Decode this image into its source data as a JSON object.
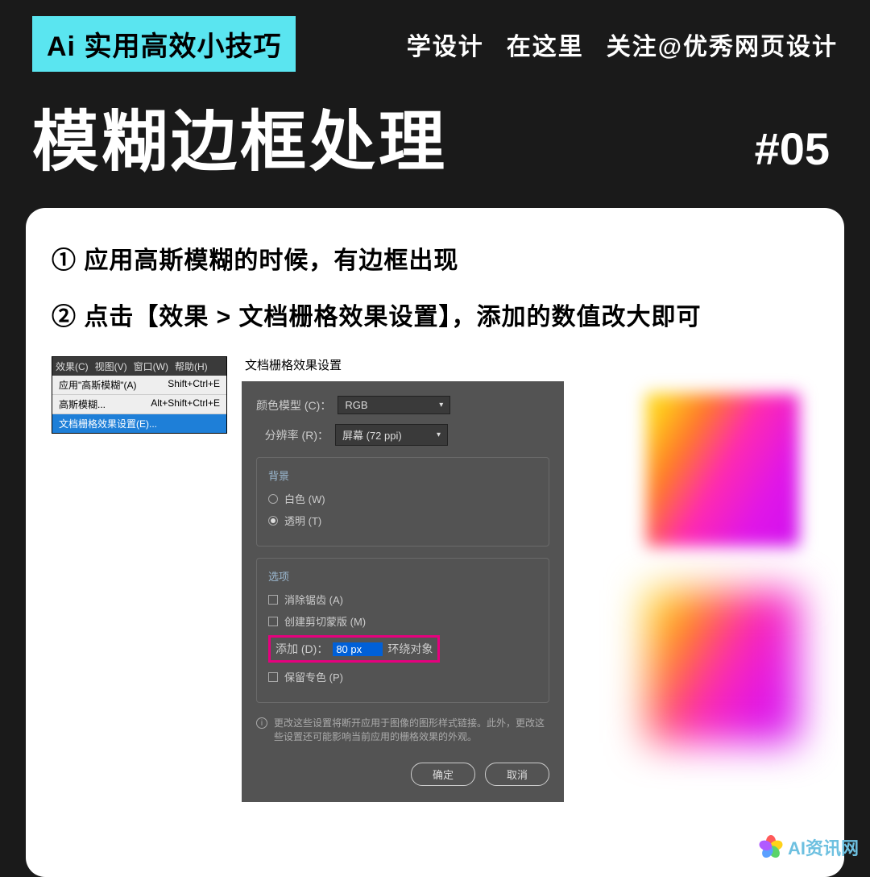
{
  "header": {
    "badge": "Ai 实用高效小技巧",
    "tag1": "学设计",
    "tag2": "在这里",
    "tag3": "关注@优秀网页设计"
  },
  "title": "模糊边框处理",
  "hash": "#05",
  "steps": {
    "s1": "① 应用高斯模糊的时候，有边框出现",
    "s2": "② 点击【效果 > 文档栅格效果设置】，添加的数值改大即可"
  },
  "menu": {
    "bar": {
      "effect": "效果(C)",
      "view": "视图(V)",
      "window": "窗口(W)",
      "help": "帮助(H)"
    },
    "row1": {
      "label": "应用\"高斯模糊\"(A)",
      "shortcut": "Shift+Ctrl+E"
    },
    "row2": {
      "label": "高斯模糊...",
      "shortcut": "Alt+Shift+Ctrl+E"
    },
    "row3": {
      "label": "文档栅格效果设置(E)..."
    }
  },
  "dialog": {
    "title": "文档栅格效果设置",
    "colorModelLabel": "颜色模型 (C)：",
    "colorModelValue": "RGB",
    "resolutionLabel": "分辨率 (R)：",
    "resolutionValue": "屏幕 (72 ppi)",
    "bgTitle": "背景",
    "bgWhite": "白色 (W)",
    "bgTransparent": "透明 (T)",
    "optTitle": "选项",
    "optAnti": "消除锯齿 (A)",
    "optClip": "创建剪切蒙版 (M)",
    "addLabel": "添加 (D)：",
    "addValue": "80 px",
    "addSuffix": "环绕对象",
    "optSpot": "保留专色 (P)",
    "info": "更改这些设置将断开应用于图像的图形样式链接。此外，更改这些设置还可能影响当前应用的栅格效果的外观。",
    "ok": "确定",
    "cancel": "取消"
  },
  "watermark": "AI资讯网"
}
